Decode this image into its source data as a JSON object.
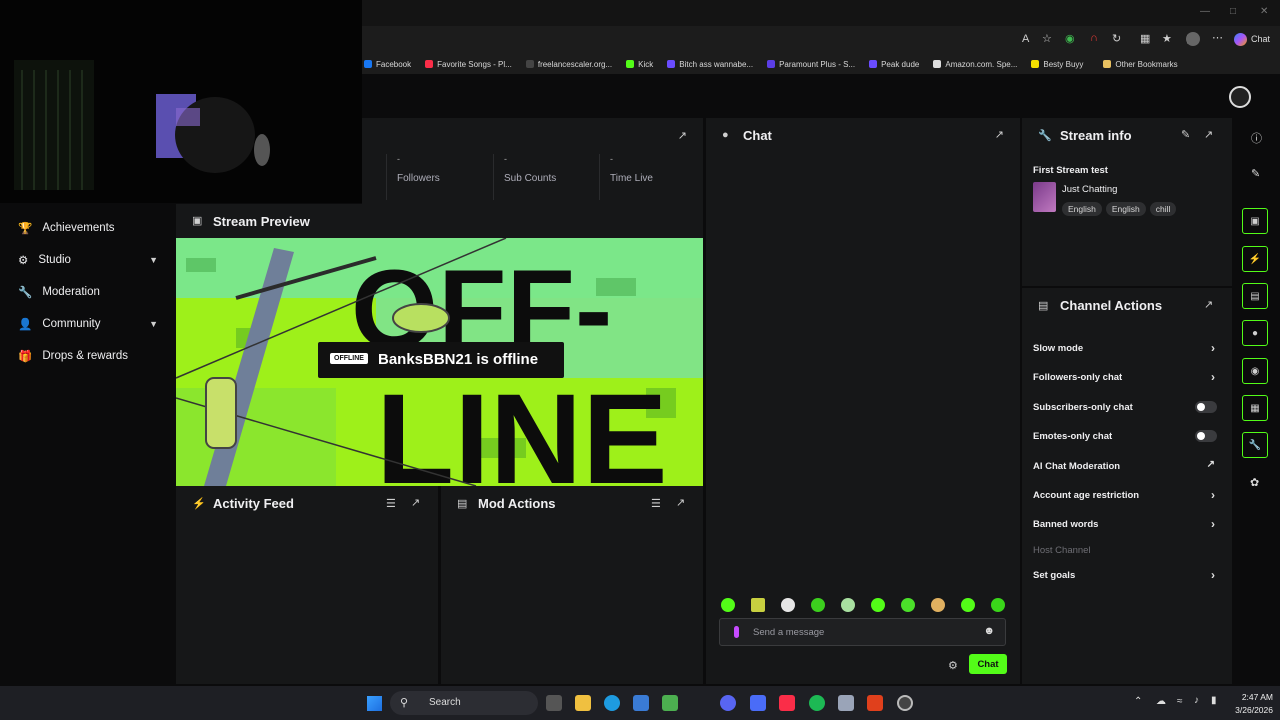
{
  "browser": {
    "bookmarks": [
      {
        "label": "Facebook",
        "color": "#1877f2"
      },
      {
        "label": "Favorite Songs - Pl...",
        "color": "#fa2d48"
      },
      {
        "label": "freelancescaler.org...",
        "color": "#444444"
      },
      {
        "label": "Kick",
        "color": "#53fc18"
      },
      {
        "label": "Bitch ass wannabe...",
        "color": "#6a4cff"
      },
      {
        "label": "Paramount Plus - S...",
        "color": "#5b3ee6"
      },
      {
        "label": "Peak dude",
        "color": "#6a4cff"
      },
      {
        "label": "Amazon.com. Spe...",
        "color": "#dddddd"
      },
      {
        "label": "Besty Buyy",
        "color": "#f5e000"
      },
      {
        "label": "Other Bookmarks",
        "color": "#e8c060"
      }
    ],
    "chat_button": "Chat"
  },
  "stats": [
    {
      "value": "-",
      "label": "Followers"
    },
    {
      "value": "-",
      "label": "Sub Counts"
    },
    {
      "value": "-",
      "label": "Time Live"
    }
  ],
  "sidebar": {
    "items": [
      {
        "label": "Achievements",
        "icon": "trophy-icon"
      },
      {
        "label": "Studio",
        "icon": "studio-icon"
      },
      {
        "label": "Moderation",
        "icon": "wrench-icon"
      },
      {
        "label": "Community",
        "icon": "person-icon"
      },
      {
        "label": "Drops & rewards",
        "icon": "gift-icon"
      }
    ]
  },
  "preview": {
    "title": "Stream Preview",
    "offline_badge": "OFFLINE",
    "offline_text": "BanksBBN21 is offline",
    "big_line1": "OFF-",
    "big_line2": "LINE"
  },
  "activity": {
    "title": "Activity Feed"
  },
  "modactions": {
    "title": "Mod Actions"
  },
  "chat": {
    "title": "Chat",
    "placeholder": "Send a message",
    "send_label": "Chat"
  },
  "streaminfo": {
    "title": "Stream info",
    "stream_title": "First Stream test",
    "category": "Just Chatting",
    "tags": [
      "English",
      "English",
      "chill"
    ]
  },
  "channel_actions": {
    "title": "Channel Actions",
    "items": [
      {
        "label": "Slow mode",
        "control": "arrow"
      },
      {
        "label": "Followers-only chat",
        "control": "arrow"
      },
      {
        "label": "Subscribers-only chat",
        "control": "toggle"
      },
      {
        "label": "Emotes-only chat",
        "control": "toggle"
      },
      {
        "label": "AI Chat Moderation",
        "control": "external"
      },
      {
        "label": "Account age restriction",
        "control": "arrow"
      },
      {
        "label": "Banned words",
        "control": "arrow"
      },
      {
        "label": "Host Channel",
        "control": "disabled"
      },
      {
        "label": "Set goals",
        "control": "arrow"
      }
    ]
  },
  "taskbar": {
    "search": "Search",
    "time": "2:47 AM",
    "date": "3/26/2026"
  },
  "colors": {
    "accent": "#53fc18",
    "panel": "#161718",
    "bg": "#0b0b0c"
  }
}
